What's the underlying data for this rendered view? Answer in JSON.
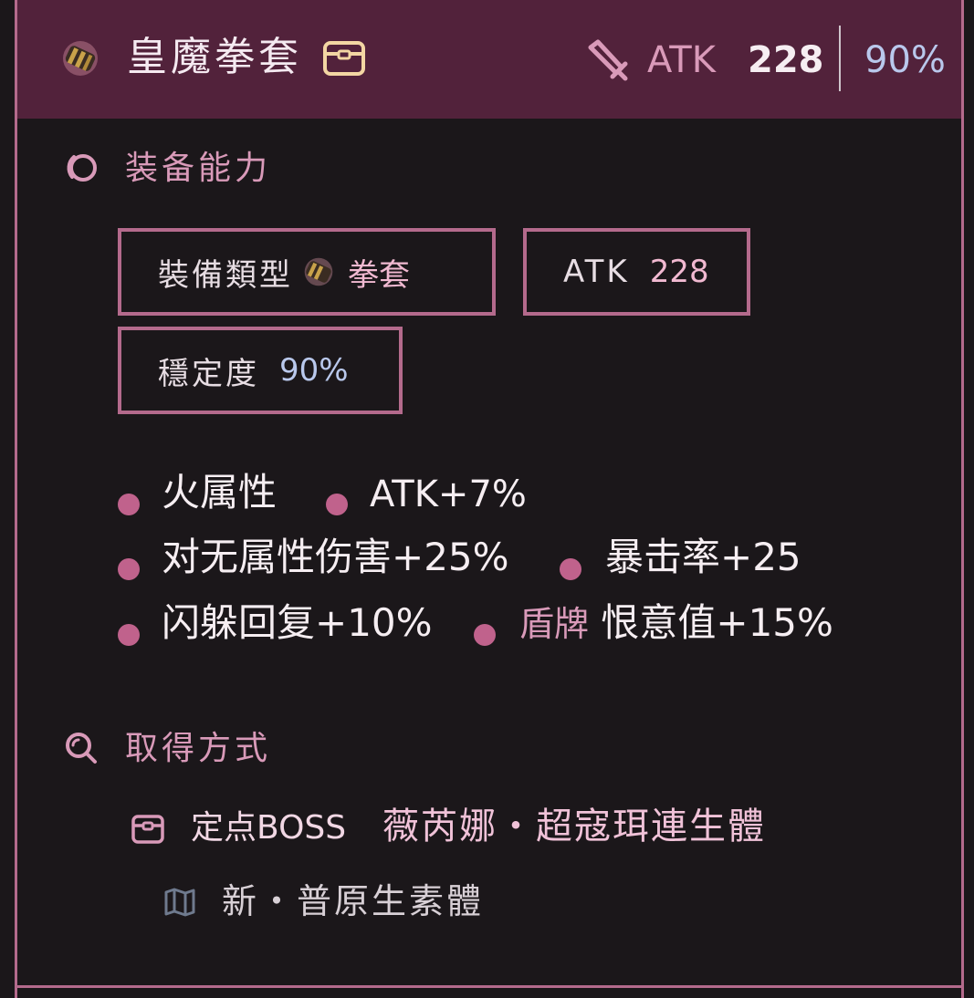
{
  "header": {
    "item_name": "皇魔拳套",
    "atk_label": "ATK",
    "atk_value": "228",
    "stability": "90%"
  },
  "abilities": {
    "title": "装备能力",
    "tags": {
      "equip_type_label": "裝備類型",
      "equip_type_value": "拳套",
      "atk_label": "ATK",
      "atk_value": "228",
      "stability_label": "穩定度",
      "stability_value": "90%"
    },
    "bonuses": [
      "火属性",
      "ATK+7%",
      "对无属性伤害+25%",
      "暴击率+25",
      "闪躲回复+10%",
      "恨意值+15%"
    ],
    "shield_prefix": "盾牌"
  },
  "acquisition": {
    "title": "取得方式",
    "boss_label": "定点BOSS",
    "boss_name": "薇芮娜・超寇珥連生體",
    "location": "新・普原生素體"
  },
  "colors": {
    "header_bg": "#52223b",
    "accent_pink": "#b46a8c",
    "bullet": "#c0628c",
    "stability_blue": "#b9c8ec",
    "body_bg": "#1b171a"
  },
  "icons": {
    "item": "gauntlet-icon",
    "chest": "chest-icon",
    "atk": "sword-icon",
    "abilities": "swirl-icon",
    "acquisition": "search-icon",
    "boss": "chest-icon",
    "location": "map-icon"
  }
}
